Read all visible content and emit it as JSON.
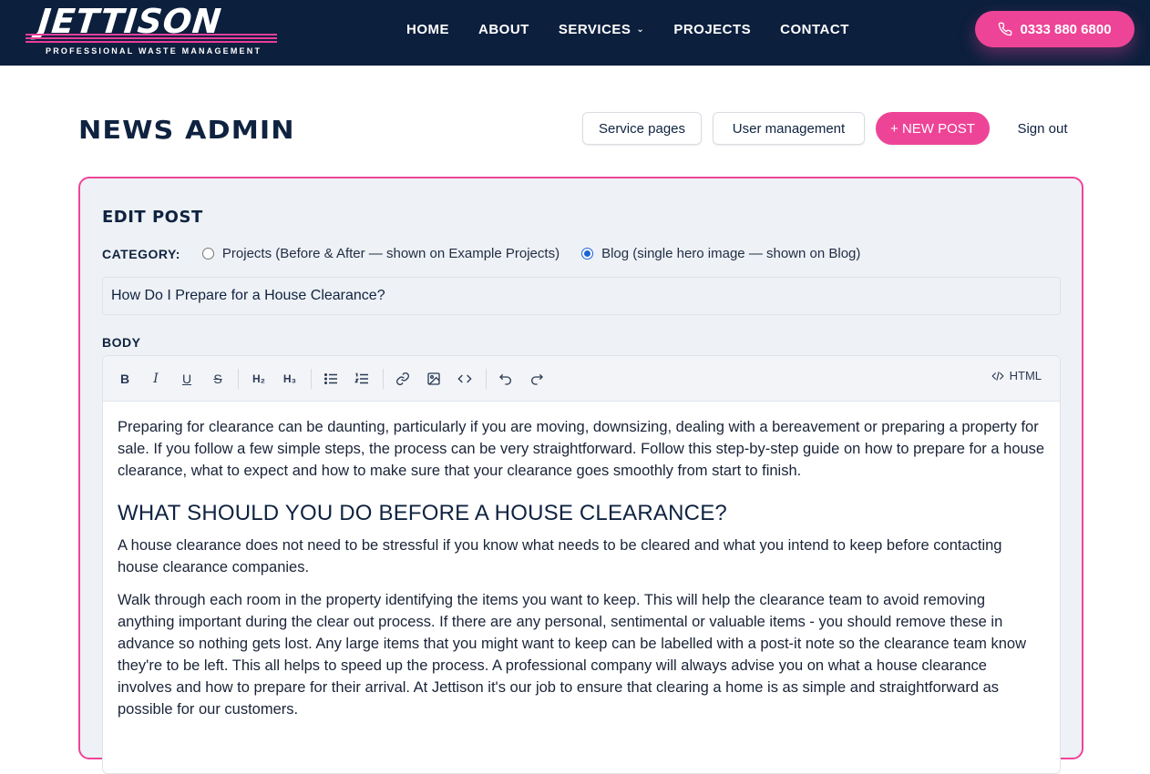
{
  "brand": {
    "name": "JETTISON",
    "tagline": "PROFESSIONAL WASTE MANAGEMENT",
    "accent": "#ee4497",
    "navy": "#0c1f3d"
  },
  "nav": {
    "items": [
      "HOME",
      "ABOUT",
      "SERVICES",
      "PROJECTS",
      "CONTACT"
    ],
    "phone": "0333 880 6800"
  },
  "page": {
    "title": "NEWS ADMIN",
    "buttons": {
      "service_pages": "Service pages",
      "user_management": "User management",
      "new_post": "+ NEW POST",
      "sign_out": "Sign out"
    }
  },
  "editor": {
    "heading": "EDIT POST",
    "category_label": "CATEGORY:",
    "categories": [
      {
        "label": "Projects (Before & After — shown on Example Projects)",
        "selected": false
      },
      {
        "label": "Blog (single hero image — shown on Blog)",
        "selected": true
      }
    ],
    "post_title": "How Do I Prepare for a House Clearance?",
    "body_label": "BODY",
    "toolbar": {
      "html_label": "HTML"
    },
    "content": {
      "p1": "Preparing for clearance can be daunting, particularly if you are moving, downsizing, dealing with a bereavement or preparing a property for sale. If you follow a few simple steps, the process can be very straightforward.  Follow this step-by-step guide on how to prepare for a house clearance, what to expect and how to make sure that your clearance goes smoothly from start to finish.",
      "h1": "WHAT SHOULD YOU DO BEFORE A HOUSE CLEARANCE?",
      "p2": "A house clearance does not need to be stressful if you know what needs to be cleared and what you intend to keep before contacting house clearance companies.",
      "p3": "Walk through each room in the property identifying the items you want to keep. This will help the clearance team to avoid removing anything important during the clear out process. If there are any personal, sentimental or valuable items - you should remove these in advance so nothing gets lost.  Any large items that you might want to keep can be labelled with a post-it note so the clearance team know they're to be left.  This all helps to speed up the process. A professional company will always advise you on what a house clearance involves and how to prepare for their arrival. At Jettison it's our job to ensure that clearing a home is as simple and straightforward as possible for our customers."
    }
  }
}
